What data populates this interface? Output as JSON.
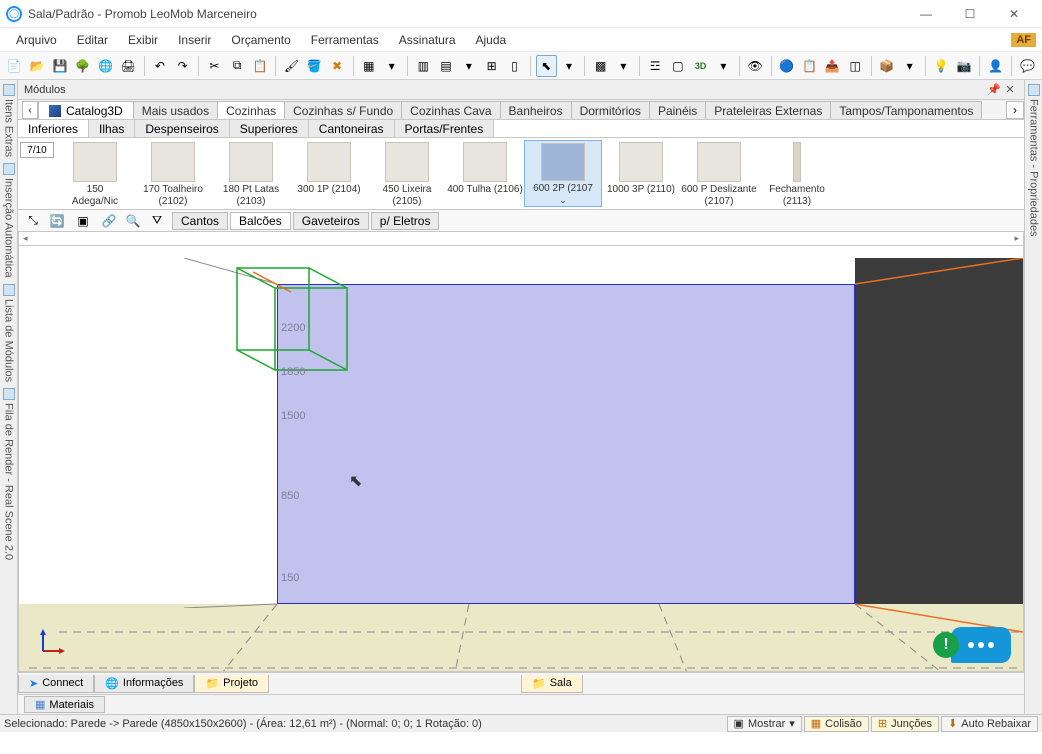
{
  "window": {
    "title": "Sala/Padrão - Promob LeoMob Marceneiro"
  },
  "menu": {
    "items": [
      "Arquivo",
      "Editar",
      "Exibir",
      "Inserir",
      "Orçamento",
      "Ferramentas",
      "Assinatura",
      "Ajuda"
    ],
    "badge": "AF"
  },
  "panel": {
    "title": "Módulos"
  },
  "catalog": {
    "label": "Catalog3D"
  },
  "topTabs": [
    "Mais usados",
    "Cozinhas",
    "Cozinhas s/ Fundo",
    "Cozinhas Cava",
    "Banheiros",
    "Dormitórios",
    "Painéis",
    "Prateleiras Externas",
    "Tampos/Tamponamentos"
  ],
  "topTabActive": "Cozinhas",
  "subTabs": [
    "Inferiores",
    "Ilhas",
    "Despenseiros",
    "Superiores",
    "Cantoneiras",
    "Portas/Frentes"
  ],
  "subTabActive": "Inferiores",
  "gallery": {
    "count": "7/10",
    "items": [
      {
        "l1": "150",
        "l2": "Adega/Nic"
      },
      {
        "l1": "170 Toalheiro",
        "l2": "(2102)"
      },
      {
        "l1": "180 Pt Latas",
        "l2": "(2103)"
      },
      {
        "l1": "300 1P (2104)",
        "l2": ""
      },
      {
        "l1": "450 Lixeira",
        "l2": "(2105)"
      },
      {
        "l1": "400 Tulha (2106)",
        "l2": ""
      },
      {
        "l1": "600 2P (2107",
        "l2": ""
      },
      {
        "l1": "1000 3P (2110)",
        "l2": ""
      },
      {
        "l1": "600 P Deslizante",
        "l2": "(2107)"
      },
      {
        "l1": "Fechamento",
        "l2": "(2113)"
      }
    ],
    "selectedIndex": 6
  },
  "row2Tabs": [
    "Cantos",
    "Balcões",
    "Gaveteiros",
    "p/ Eletros"
  ],
  "row2Active": "Balcões",
  "leftSide": [
    "Itens Extras",
    "Inserção Automática",
    "Lista de Módulos",
    "Fila de Render - Real Scene 2.0"
  ],
  "rightSide": [
    "Ferramentas - Propriedades"
  ],
  "dims": {
    "d1": "2200",
    "d2": "1850",
    "d3": "1500",
    "d4": "850",
    "d5": "150"
  },
  "bottom": {
    "connect": "Connect",
    "info": "Informações",
    "projeto": "Projeto",
    "sala": "Sala",
    "materiais": "Materiais"
  },
  "status": {
    "text": "Selecionado: Parede -> Parede (4850x150x2600) - (Área: 12,61 m²) - (Normal: 0; 0; 1 Rotação: 0)",
    "mostrar": "Mostrar",
    "colisao": "Colisão",
    "juncoes": "Junções",
    "auto": "Auto Rebaixar"
  }
}
